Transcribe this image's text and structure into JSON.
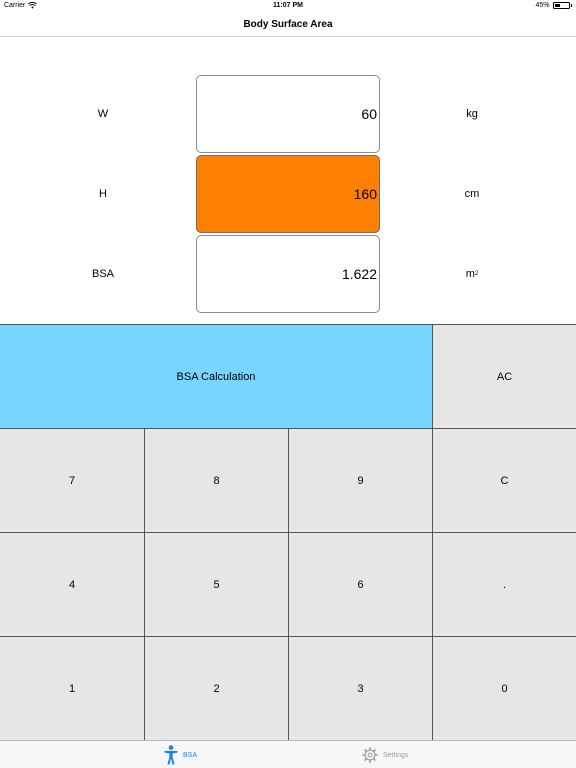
{
  "status_bar": {
    "carrier": "Carrier",
    "time": "11:07 PM",
    "battery_percent": "45%",
    "battery_level": 0.45
  },
  "nav": {
    "title": "Body Surface Area"
  },
  "form": {
    "rows": [
      {
        "label": "W",
        "value": "60",
        "unit": "kg"
      },
      {
        "label": "H",
        "value": "160",
        "unit": "cm"
      },
      {
        "label": "BSA",
        "value": "1.622",
        "unit_base": "m",
        "unit_sup": "2"
      }
    ]
  },
  "keypad": {
    "calc_label": "BSA Calculation",
    "all_clear_label": "AC",
    "keys": [
      [
        "7",
        "8",
        "9",
        "C"
      ],
      [
        "4",
        "5",
        "6",
        "."
      ],
      [
        "1",
        "2",
        "3",
        "0"
      ]
    ]
  },
  "tab_bar": {
    "tabs": [
      {
        "label": "BSA",
        "icon": "person-icon",
        "selected": true
      },
      {
        "label": "Settings",
        "icon": "gear-icon",
        "selected": false
      }
    ]
  },
  "colors": {
    "active_field": "#ff8000",
    "calc_button": "#76d6ff",
    "key_background": "#e6e6e6",
    "tab_selected": "#1a7cf5",
    "tab_unselected": "#9a9a9a"
  }
}
